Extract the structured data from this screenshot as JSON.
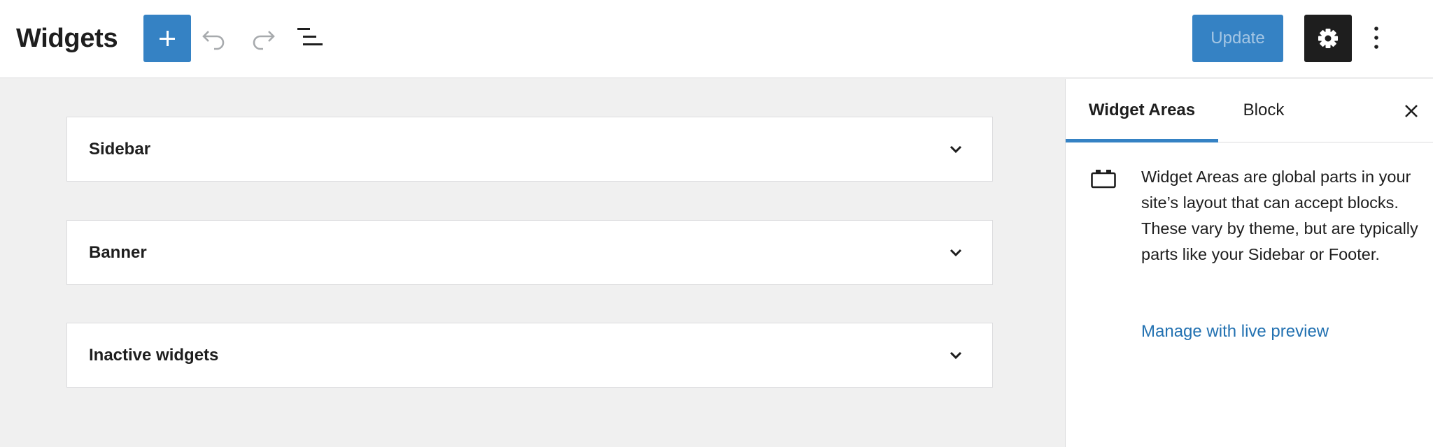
{
  "header": {
    "title": "Widgets",
    "add_icon": "plus-icon",
    "undo_icon": "undo-icon",
    "redo_icon": "redo-icon",
    "list_view_icon": "list-view-icon",
    "update_label": "Update",
    "settings_icon": "gear-icon",
    "more_icon": "more-vertical-icon"
  },
  "widget_areas": [
    {
      "label": "Sidebar",
      "icon": "chevron-down-icon"
    },
    {
      "label": "Banner",
      "icon": "chevron-down-icon"
    },
    {
      "label": "Inactive widgets",
      "icon": "chevron-down-icon"
    }
  ],
  "sidebar": {
    "tabs": [
      {
        "label": "Widget Areas",
        "active": true
      },
      {
        "label": "Block",
        "active": false
      }
    ],
    "close_icon": "close-icon",
    "info_icon": "block-default-icon",
    "info_text": "Widget Areas are global parts in your site’s layout that can accept blocks. These vary by theme, but are typically parts like your Sidebar or Footer.",
    "manage_link": "Manage with live preview"
  },
  "colors": {
    "accent": "#3582c4",
    "dark": "#1e1e1e",
    "link": "#2271b1",
    "canvas": "#f0f0f0"
  }
}
